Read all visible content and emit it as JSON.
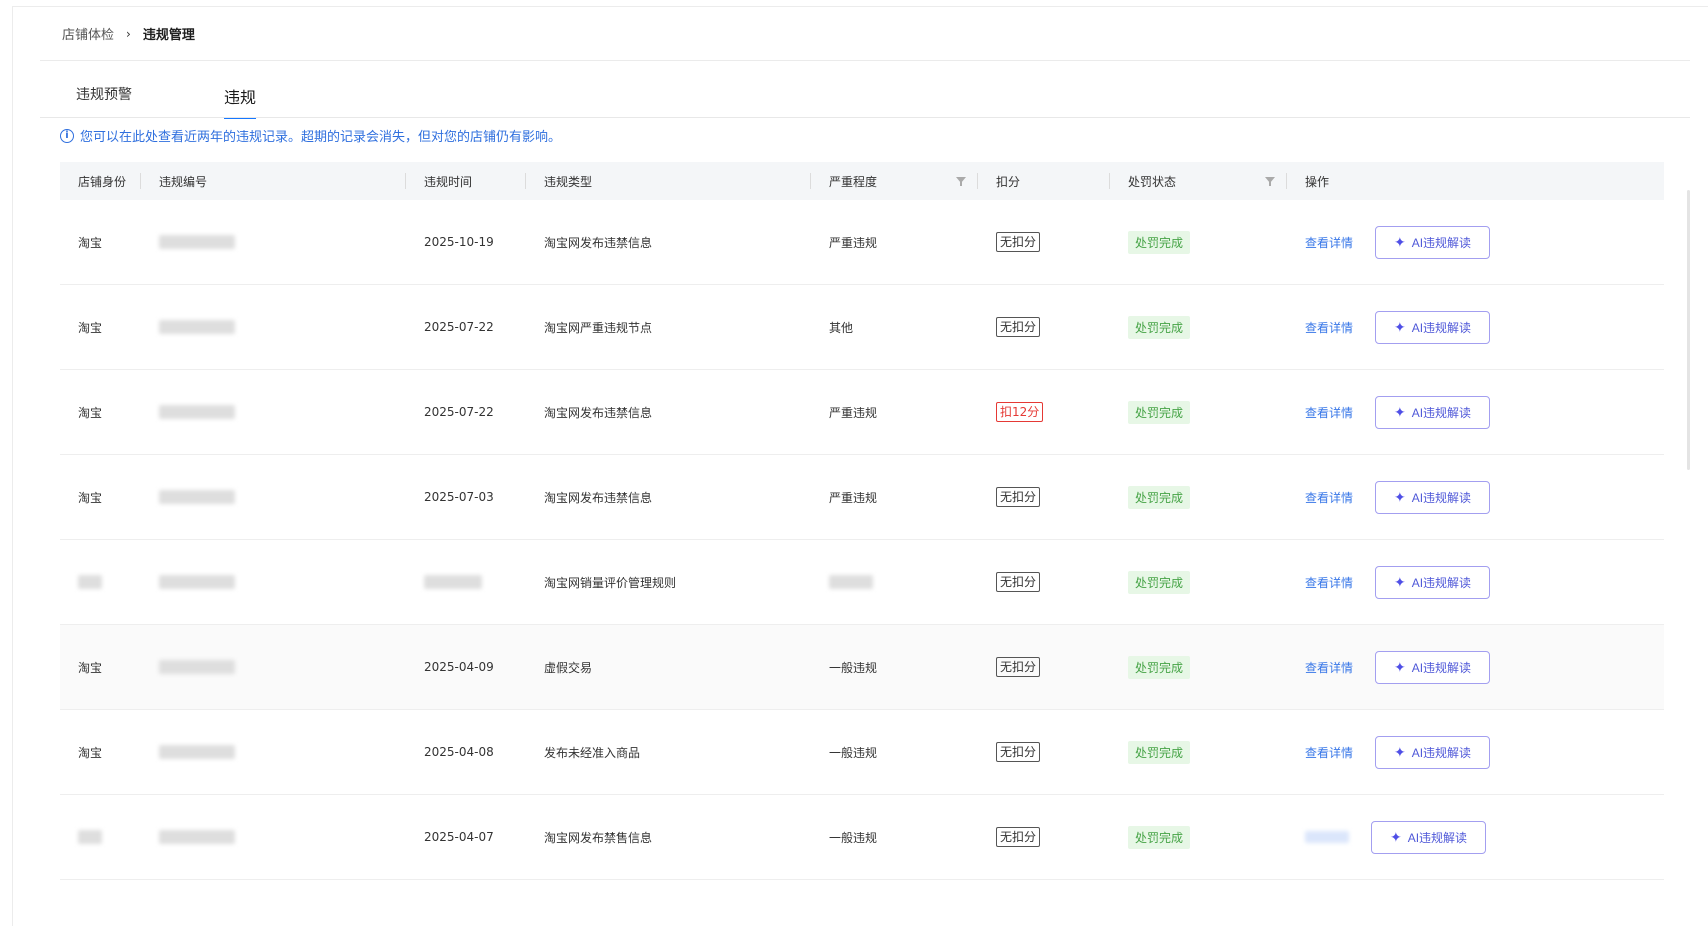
{
  "breadcrumb": {
    "parent": "店铺体检",
    "separator": "›",
    "current": "违规管理"
  },
  "tabs": [
    {
      "label": "违规预警"
    },
    {
      "label": "违规"
    }
  ],
  "notice": {
    "icon": "info-icon",
    "text": "您可以在此处查看近两年的违规记录。超期的记录会消失，但对您的店铺仍有影响。"
  },
  "table": {
    "columns": [
      "店铺身份",
      "违规编号",
      "违规时间",
      "违规类型",
      "严重程度",
      "扣分",
      "处罚状态",
      "操作"
    ],
    "filterable_columns": [
      "严重程度",
      "处罚状态"
    ],
    "rows": [
      {
        "shop": "淘宝",
        "date": "2025-10-19",
        "type": "淘宝网发布违禁信息",
        "severity": "严重违规",
        "deduct": "无扣分",
        "deduct_warn": false,
        "status": "处罚完成",
        "detail": "查看详情",
        "ai": "AI违规解读"
      },
      {
        "shop": "淘宝",
        "date": "2025-07-22",
        "type": "淘宝网严重违规节点",
        "severity": "其他",
        "deduct": "无扣分",
        "deduct_warn": false,
        "status": "处罚完成",
        "detail": "查看详情",
        "ai": "AI违规解读"
      },
      {
        "shop": "淘宝",
        "date": "2025-07-22",
        "type": "淘宝网发布违禁信息",
        "severity": "严重违规",
        "deduct": "扣12分",
        "deduct_warn": true,
        "status": "处罚完成",
        "detail": "查看详情",
        "ai": "AI违规解读"
      },
      {
        "shop": "淘宝",
        "date": "2025-07-03",
        "type": "淘宝网发布违禁信息",
        "severity": "严重违规",
        "deduct": "无扣分",
        "deduct_warn": false,
        "status": "处罚完成",
        "detail": "查看详情",
        "ai": "AI违规解读"
      },
      {
        "shop": "",
        "date": "",
        "type": "淘宝网销量评价管理规则",
        "severity": "",
        "deduct": "无扣分",
        "deduct_warn": false,
        "status": "处罚完成",
        "detail": "查看详情",
        "ai": "AI违规解读"
      },
      {
        "shop": "淘宝",
        "date": "2025-04-09",
        "type": "虚假交易",
        "severity": "一般违规",
        "deduct": "无扣分",
        "deduct_warn": false,
        "status": "处罚完成",
        "detail": "查看详情",
        "ai": "AI违规解读"
      },
      {
        "shop": "淘宝",
        "date": "2025-04-08",
        "type": "发布未经准入商品",
        "severity": "一般违规",
        "deduct": "无扣分",
        "deduct_warn": false,
        "status": "处罚完成",
        "detail": "查看详情",
        "ai": "AI违规解读"
      },
      {
        "shop": "",
        "date": "2025-04-07",
        "type": "淘宝网发布禁售信息",
        "severity": "一般违规",
        "deduct": "无扣分",
        "deduct_warn": false,
        "status": "处罚完成",
        "detail": "",
        "ai": "AI违规解读"
      }
    ]
  },
  "colors": {
    "link": "#3877e8",
    "notice": "#2f6fde",
    "tab_active": "#1677ff",
    "status_green": "#47a447",
    "deduct_red": "#e53935",
    "ai_border": "#a39ff0"
  }
}
